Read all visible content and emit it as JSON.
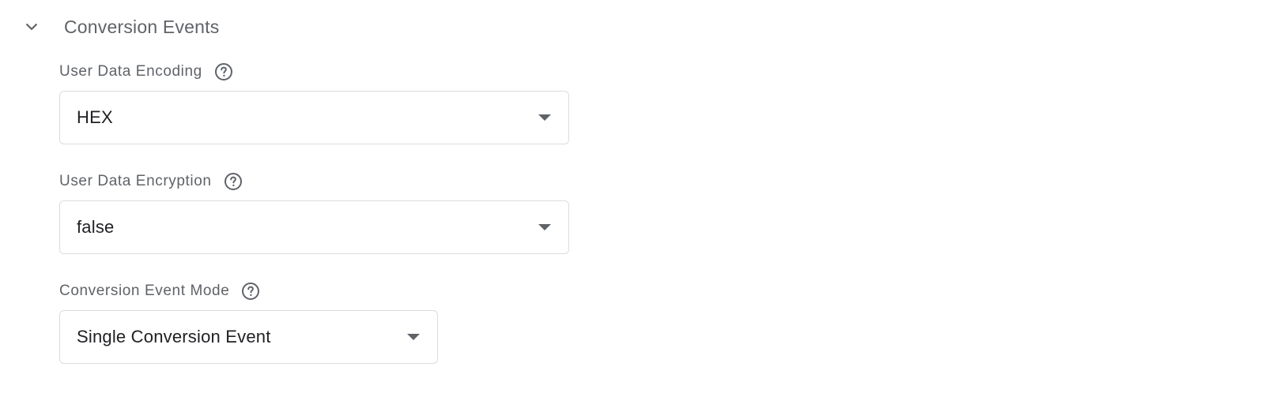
{
  "section": {
    "title": "Conversion Events",
    "expanded": true,
    "chevron_icon": "chevron-down-icon"
  },
  "fields": [
    {
      "label": "User Data Encoding",
      "help_icon": "help-circle-icon",
      "value": "HEX",
      "dropdown_icon": "caret-down-icon"
    },
    {
      "label": "User Data Encryption",
      "help_icon": "help-circle-icon",
      "value": "false",
      "dropdown_icon": "caret-down-icon"
    },
    {
      "label": "Conversion Event Mode",
      "help_icon": "help-circle-icon",
      "value": "Single Conversion Event",
      "dropdown_icon": "caret-down-icon"
    }
  ],
  "colors": {
    "label_text": "#5f6368",
    "value_text": "#202124",
    "border": "#dadce0"
  }
}
